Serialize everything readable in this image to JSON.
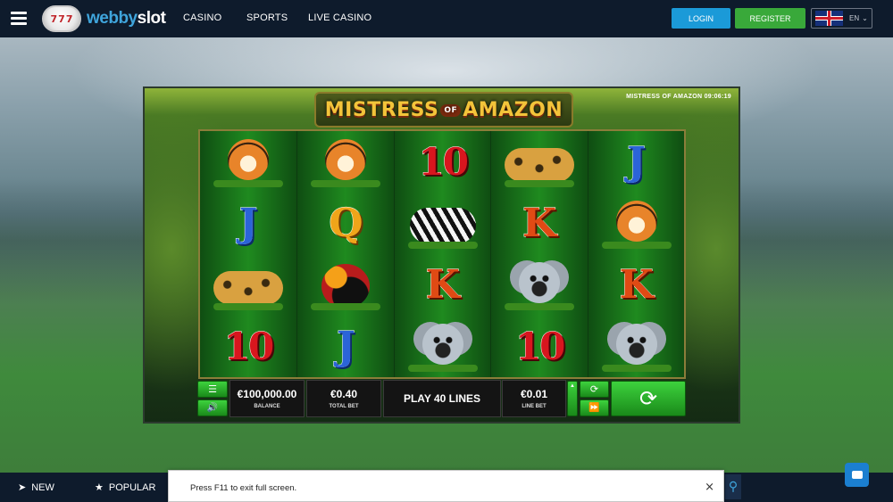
{
  "header": {
    "logo_digits": [
      "7",
      "7",
      "7"
    ],
    "logo_brand_a": "webby",
    "logo_brand_b": "slot",
    "nav": [
      "CASINO",
      "SPORTS",
      "LIVE CASINO"
    ],
    "login_label": "LOGIN",
    "register_label": "REGISTER",
    "language": "EN",
    "colors": {
      "bar": "#0e1b2c",
      "login": "#1b9ad8",
      "register": "#39a93a"
    }
  },
  "game": {
    "title_a": "MISTRESS",
    "title_of": "OF",
    "title_b": "AMAZON",
    "clock": "MISTRESS OF AMAZON 09:06:19",
    "reels": [
      [
        {
          "type": "animal",
          "name": "tiger"
        },
        {
          "type": "card",
          "value": "J"
        },
        {
          "type": "animal",
          "name": "leopard"
        },
        {
          "type": "card",
          "value": "10"
        }
      ],
      [
        {
          "type": "animal",
          "name": "tiger"
        },
        {
          "type": "card",
          "value": "Q"
        },
        {
          "type": "animal",
          "name": "toucan"
        },
        {
          "type": "card",
          "value": "J"
        }
      ],
      [
        {
          "type": "card",
          "value": "10"
        },
        {
          "type": "animal",
          "name": "zebra"
        },
        {
          "type": "card",
          "value": "K"
        },
        {
          "type": "animal",
          "name": "koala"
        }
      ],
      [
        {
          "type": "animal",
          "name": "leopard"
        },
        {
          "type": "card",
          "value": "K"
        },
        {
          "type": "animal",
          "name": "koala"
        },
        {
          "type": "card",
          "value": "10"
        }
      ],
      [
        {
          "type": "card",
          "value": "J"
        },
        {
          "type": "animal",
          "name": "tiger"
        },
        {
          "type": "card",
          "value": "K"
        },
        {
          "type": "animal",
          "name": "koala"
        }
      ]
    ],
    "balance_value": "€100,000.00",
    "balance_label": "BALANCE",
    "total_bet_value": "€0.40",
    "total_bet_label": "TOTAL BET",
    "play_lines": "PLAY 40 LINES",
    "line_bet_value": "€0.01",
    "line_bet_label": "LINE BET",
    "icons": {
      "menu": "menu-icon",
      "sound": "speaker-icon",
      "autoplay": "autoplay-icon",
      "fast": "fast-forward-icon",
      "spin": "spin-icon"
    }
  },
  "side_controls": [
    "close-icon",
    "expand-icon",
    "zoom-in-icon",
    "zoom-out-icon"
  ],
  "bottom": {
    "items": [
      {
        "label": "NEW",
        "icon": "rocket-icon"
      },
      {
        "label": "POPULAR",
        "icon": "star-icon"
      }
    ]
  },
  "toast": {
    "message": "Press F11 to exit full screen.",
    "close": "×"
  }
}
